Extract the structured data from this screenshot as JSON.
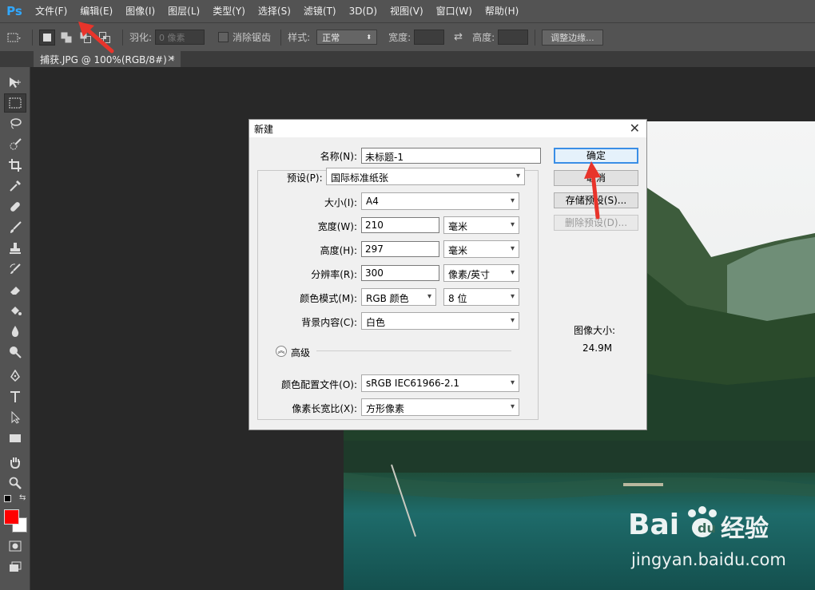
{
  "app": {
    "logo": "Ps"
  },
  "menu": [
    "文件(F)",
    "编辑(E)",
    "图像(I)",
    "图层(L)",
    "类型(Y)",
    "选择(S)",
    "滤镜(T)",
    "3D(D)",
    "视图(V)",
    "窗口(W)",
    "帮助(H)"
  ],
  "options": {
    "feather_label": "羽化:",
    "feather_value": "0 像素",
    "antialias_label": "消除锯齿",
    "style_label": "样式:",
    "style_value": "正常",
    "width_label": "宽度:",
    "height_label": "高度:",
    "refine_button": "调整边缘..."
  },
  "tab": {
    "title": "捕获.JPG @ 100%(RGB/8#) *",
    "close": "×"
  },
  "dialog": {
    "title": "新建",
    "close": "✕",
    "name_label": "名称(N):",
    "name_value": "未标题-1",
    "preset_label": "预设(P):",
    "preset_value": "国际标准纸张",
    "size_label": "大小(I):",
    "size_value": "A4",
    "width_label": "宽度(W):",
    "width_value": "210",
    "width_unit": "毫米",
    "height_label": "高度(H):",
    "height_value": "297",
    "height_unit": "毫米",
    "resolution_label": "分辨率(R):",
    "resolution_value": "300",
    "resolution_unit": "像素/英寸",
    "color_mode_label": "颜色模式(M):",
    "color_mode_value": "RGB 颜色",
    "bit_depth_value": "8 位",
    "background_label": "背景内容(C):",
    "background_value": "白色",
    "advanced_label": "高级",
    "profile_label": "颜色配置文件(O):",
    "profile_value": "sRGB IEC61966-2.1",
    "aspect_label": "像素长宽比(X):",
    "aspect_value": "方形像素",
    "ok_button": "确定",
    "cancel_button": "取消",
    "save_preset_button": "存储预设(S)...",
    "delete_preset_button": "删除预设(D)...",
    "image_size_label": "图像大小:",
    "image_size_value": "24.9M"
  },
  "colors": {
    "foreground": "#ff0000",
    "background": "#ffffff",
    "annotation": "#e8342b"
  },
  "watermark": {
    "brand_cn": "经验",
    "url": "jingyan.baidu.com"
  }
}
